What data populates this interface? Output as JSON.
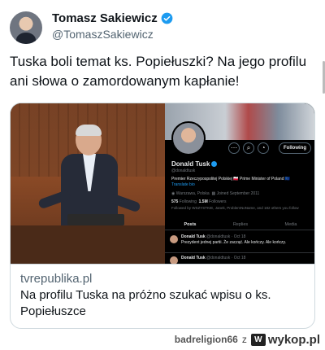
{
  "author": {
    "name": "Tomasz Sakiewicz",
    "handle": "@TomaszSakiewicz"
  },
  "tweet": {
    "text": "Tuska boli temat ks. Popiełuszki? Na jego profilu ani słowa o zamordowanym kapłanie!"
  },
  "card": {
    "domain": "tvrepublika.pl",
    "title": "Na profilu Tuska na próżno szukać wpisu o ks. Popiełuszce",
    "embedded_profile": {
      "name": "Donald Tusk",
      "handle": "@donaldtusk",
      "bio": "Premier Rzeczypospolitej Polskiej 🇵🇱 Prime Minister of Poland 🇪🇺",
      "translate": "Translate bio",
      "location": "Warszawa, Polska",
      "joined": "Joined September 2011",
      "following_count": "575",
      "following_label": "Following",
      "followers_count": "1.5M",
      "followers_label": "Followers",
      "followed_by": "Followed by WSZYSTKIE, Janek, ProblemNoName, and 182 others you follow",
      "follow_button": "Following",
      "tabs": [
        "Posts",
        "Replies",
        "Media"
      ],
      "posts": [
        {
          "name": "Donald Tusk",
          "meta": "@donaldtusk · Oct 18",
          "text": "Prezydent jednej partii. Że zacząć. Ale kończy. Ale kończy."
        },
        {
          "name": "Donald Tusk",
          "meta": "@donaldtusk · Oct 18",
          "text": ""
        }
      ]
    }
  },
  "footer": {
    "username": "badreligion66",
    "separator": "z",
    "site_mark": "W",
    "site": "wykop.pl"
  },
  "colors": {
    "accent": "#1d9bf0",
    "text": "#0f1419",
    "secondary": "#536471",
    "border": "#cfd9de"
  }
}
